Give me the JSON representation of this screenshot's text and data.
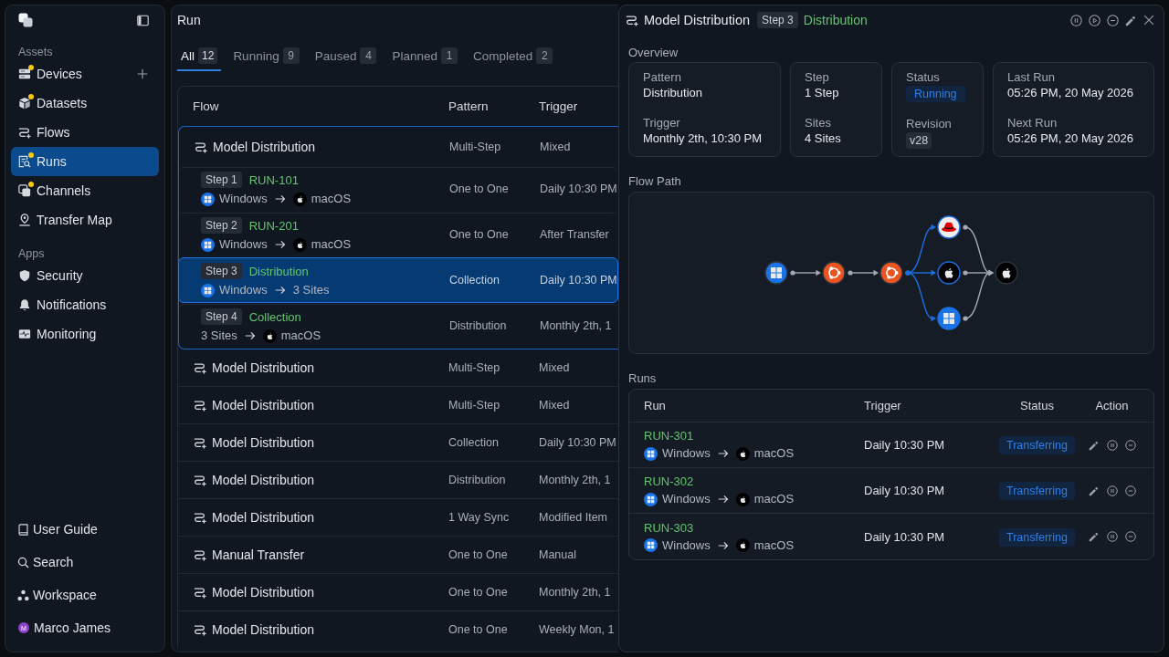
{
  "sidebar": {
    "sections": [
      {
        "title": "Assets",
        "items": [
          {
            "label": "Devices",
            "notified": true,
            "addable": true,
            "selected": false
          },
          {
            "label": "Datasets",
            "notified": true,
            "addable": false,
            "selected": false
          },
          {
            "label": "Flows",
            "notified": false,
            "addable": false,
            "selected": false
          },
          {
            "label": "Runs",
            "notified": true,
            "addable": false,
            "selected": true
          },
          {
            "label": "Channels",
            "notified": true,
            "addable": false,
            "selected": false
          },
          {
            "label": "Transfer Map",
            "notified": false,
            "addable": false,
            "selected": false
          }
        ]
      },
      {
        "title": "Apps",
        "items": [
          {
            "label": "Security",
            "notified": false,
            "addable": false,
            "selected": false
          },
          {
            "label": "Notifications",
            "notified": false,
            "addable": false,
            "selected": false
          },
          {
            "label": "Monitoring",
            "notified": false,
            "addable": false,
            "selected": false
          }
        ]
      }
    ],
    "footer": [
      {
        "label": "User Guide"
      },
      {
        "label": "Search"
      },
      {
        "label": "Workspace"
      }
    ],
    "user": {
      "name": "Marco James",
      "initial": "M"
    }
  },
  "main": {
    "title": "Run",
    "tabs": [
      {
        "label": "All",
        "count": "12",
        "selected": true
      },
      {
        "label": "Running",
        "count": "9",
        "selected": false
      },
      {
        "label": "Paused",
        "count": "4",
        "selected": false
      },
      {
        "label": "Planned",
        "count": "1",
        "selected": false
      },
      {
        "label": "Completed",
        "count": "2",
        "selected": false
      }
    ],
    "table": {
      "columns": [
        "Flow",
        "Pattern",
        "Trigger"
      ],
      "rows": [
        {
          "name": "Model Distribution",
          "pattern": "Multi-Step",
          "trigger": "Mixed",
          "expanded": true,
          "steps": [
            {
              "step": "Step 1",
              "name": "RUN-101",
              "source": {
                "label": "Windows",
                "kind": "windows"
              },
              "target": {
                "label": "macOS",
                "kind": "macos"
              },
              "pattern": "One to One",
              "trigger": "Daily 10:30 PM",
              "selected": false
            },
            {
              "step": "Step 2",
              "name": "RUN-201",
              "source": {
                "label": "Windows",
                "kind": "windows"
              },
              "target": {
                "label": "macOS",
                "kind": "macos"
              },
              "pattern": "One to One",
              "trigger": "After Transfer",
              "selected": false
            },
            {
              "step": "Step 3",
              "name": "Distribution",
              "source": {
                "label": "Windows",
                "kind": "windows"
              },
              "target": {
                "label": "3 Sites",
                "kind": "sites"
              },
              "pattern": "Collection",
              "trigger": "Daily 10:30 PM",
              "selected": true
            },
            {
              "step": "Step 4",
              "name": "Collection",
              "source": {
                "label": "3 Sites",
                "kind": "sites"
              },
              "target": {
                "label": "macOS",
                "kind": "macos"
              },
              "pattern": "Distribution",
              "trigger": "Monthly 2th, 1",
              "selected": false
            }
          ]
        },
        {
          "name": "Model Distribution",
          "pattern": "Multi-Step",
          "trigger": "Mixed",
          "expanded": false
        },
        {
          "name": "Model Distribution",
          "pattern": "Multi-Step",
          "trigger": "Mixed",
          "expanded": false
        },
        {
          "name": "Model Distribution",
          "pattern": "Collection",
          "trigger": "Daily 10:30 PM",
          "expanded": false
        },
        {
          "name": "Model Distribution",
          "pattern": "Distribution",
          "trigger": "Monthly 2th, 1",
          "expanded": false
        },
        {
          "name": "Model Distribution",
          "pattern": "1 Way Sync",
          "trigger": "Modified Item",
          "expanded": false
        },
        {
          "name": "Manual Transfer",
          "pattern": "One to One",
          "trigger": "Manual",
          "expanded": false
        },
        {
          "name": "Model Distribution",
          "pattern": "One to One",
          "trigger": "Monthly 2th, 1",
          "expanded": false
        },
        {
          "name": "Model Distribution",
          "pattern": "One to One",
          "trigger": "Weekly Mon, 1",
          "expanded": false
        }
      ]
    }
  },
  "drawer": {
    "title": "Model Distribution",
    "step": "Step 3",
    "step_name": "Distribution",
    "overview": {
      "title": "Overview",
      "cards": [
        {
          "fields": [
            {
              "label": "Pattern",
              "value": "Distribution",
              "kind": "text"
            },
            {
              "label": "Trigger",
              "value": "Monthly 2th, 10:30 PM",
              "kind": "text"
            }
          ]
        },
        {
          "fields": [
            {
              "label": "Step",
              "value": "1 Step",
              "kind": "text"
            },
            {
              "label": "Sites",
              "value": "4 Sites",
              "kind": "text"
            }
          ]
        },
        {
          "fields": [
            {
              "label": "Status",
              "value": "Running",
              "kind": "status"
            },
            {
              "label": "Revision",
              "value": "v28",
              "kind": "tag"
            }
          ]
        },
        {
          "fields": [
            {
              "label": "Last Run",
              "value": "05:26 PM, 20 May 2026",
              "kind": "text"
            },
            {
              "label": "Next Run",
              "value": "05:26 PM, 20 May 2026",
              "kind": "text"
            }
          ]
        }
      ]
    },
    "flow_path": {
      "title": "Flow Path",
      "stages": [
        {
          "nodes": [
            {
              "kind": "windows"
            }
          ]
        },
        {
          "incoming_active": false,
          "nodes": [
            {
              "kind": "ubuntu"
            }
          ]
        },
        {
          "incoming_active": false,
          "nodes": [
            {
              "kind": "ubuntu"
            }
          ]
        },
        {
          "incoming_active": true,
          "nodes": [
            {
              "kind": "redhat"
            },
            {
              "kind": "macos"
            },
            {
              "kind": "windows"
            }
          ]
        },
        {
          "incoming_active": false,
          "nodes": [
            {
              "kind": "macos"
            }
          ]
        }
      ]
    },
    "runs": {
      "title": "Runs",
      "columns": [
        "Run",
        "Trigger",
        "Status",
        "Action"
      ],
      "rows": [
        {
          "id": "RUN-301",
          "source": {
            "label": "Windows",
            "kind": "windows"
          },
          "target": {
            "label": "macOS",
            "kind": "macos"
          },
          "trigger": "Daily 10:30 PM",
          "status": "Transferring"
        },
        {
          "id": "RUN-302",
          "source": {
            "label": "Windows",
            "kind": "windows"
          },
          "target": {
            "label": "macOS",
            "kind": "macos"
          },
          "trigger": "Daily 10:30 PM",
          "status": "Transferring"
        },
        {
          "id": "RUN-303",
          "source": {
            "label": "Windows",
            "kind": "windows"
          },
          "target": {
            "label": "macOS",
            "kind": "macos"
          },
          "trigger": "Daily 10:30 PM",
          "status": "Transferring"
        }
      ]
    }
  }
}
